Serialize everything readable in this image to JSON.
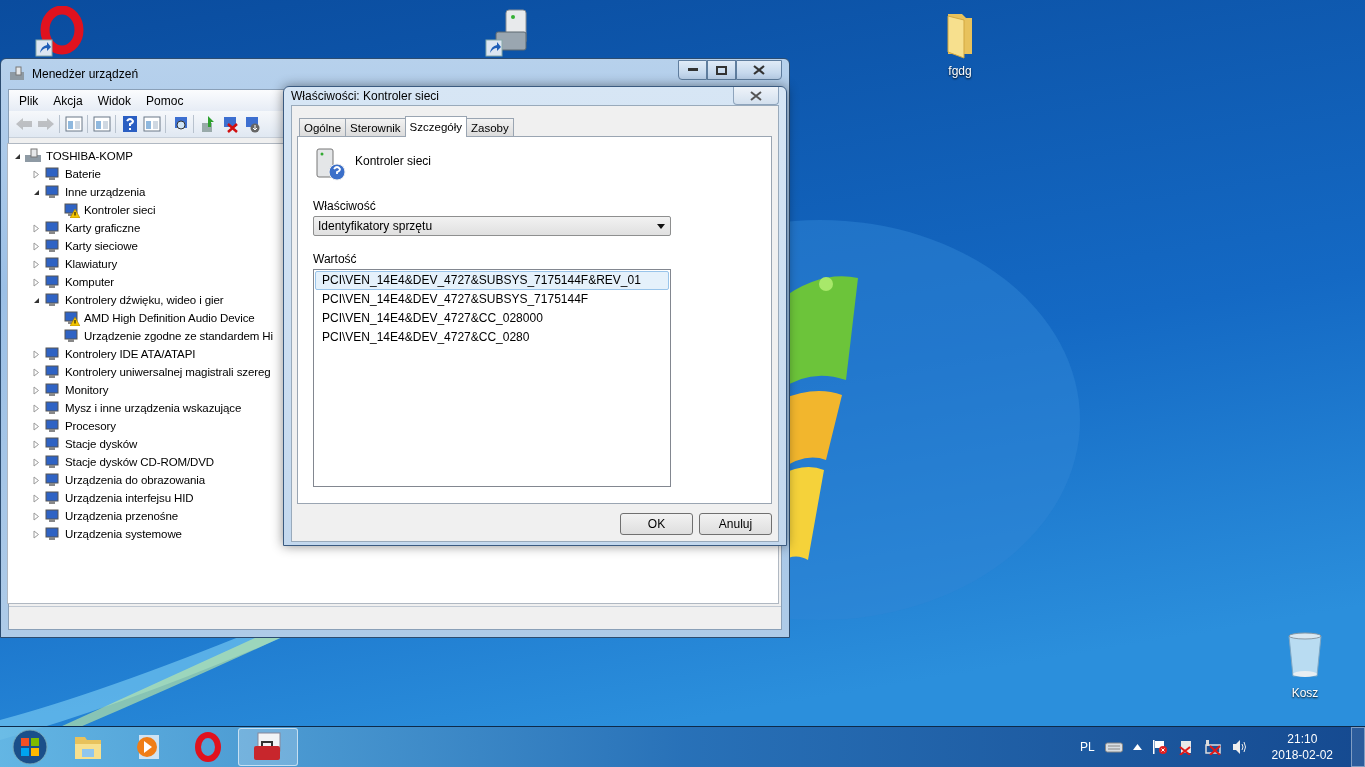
{
  "desktop_icons": [
    {
      "kind": "opera"
    },
    {
      "kind": "device-manager"
    },
    {
      "kind": "folder",
      "label": "fgdg"
    },
    {
      "kind": "recycle-bin",
      "label": "Kosz"
    }
  ],
  "device_manager": {
    "title": "Menedżer urządzeń",
    "menu": [
      "Plik",
      "Akcja",
      "Widok",
      "Pomoc"
    ],
    "toolbar": [
      {
        "kind": "back",
        "disabled": true
      },
      {
        "kind": "forward",
        "disabled": true
      },
      {
        "kind": "separator"
      },
      {
        "kind": "tree-view"
      },
      {
        "kind": "separator"
      },
      {
        "kind": "properties"
      },
      {
        "kind": "separator"
      },
      {
        "kind": "help"
      },
      {
        "kind": "action-view"
      },
      {
        "kind": "separator"
      },
      {
        "kind": "scan"
      },
      {
        "kind": "separator"
      },
      {
        "kind": "update"
      },
      {
        "kind": "uninstall"
      },
      {
        "kind": "disable"
      }
    ],
    "tree": [
      {
        "label": "TOSHIBA-KOMP",
        "expanded": true,
        "children": [
          {
            "label": "Baterie",
            "expanded": false
          },
          {
            "label": "Inne urządzenia",
            "expanded": true,
            "children": [
              {
                "label": "Kontroler sieci",
                "warning": true
              }
            ]
          },
          {
            "label": "Karty graficzne",
            "expanded": false
          },
          {
            "label": "Karty sieciowe",
            "expanded": false
          },
          {
            "label": "Klawiatury",
            "expanded": false
          },
          {
            "label": "Komputer",
            "expanded": false
          },
          {
            "label": "Kontrolery dźwięku, wideo i gier",
            "expanded": true,
            "children": [
              {
                "label": "AMD High Definition Audio Device",
                "warning": true
              },
              {
                "label": "Urządzenie zgodne ze standardem Hi",
                "warning": false
              }
            ]
          },
          {
            "label": "Kontrolery IDE ATA/ATAPI",
            "expanded": false
          },
          {
            "label": "Kontrolery uniwersalnej magistrali szereg",
            "expanded": false
          },
          {
            "label": "Monitory",
            "expanded": false
          },
          {
            "label": "Mysz i inne urządzenia wskazujące",
            "expanded": false
          },
          {
            "label": "Procesory",
            "expanded": false
          },
          {
            "label": "Stacje dysków",
            "expanded": false
          },
          {
            "label": "Stacje dysków CD-ROM/DVD",
            "expanded": false
          },
          {
            "label": "Urządzenia do obrazowania",
            "expanded": false
          },
          {
            "label": "Urządzenia interfejsu HID",
            "expanded": false
          },
          {
            "label": "Urządzenia przenośne",
            "expanded": false
          },
          {
            "label": "Urządzenia systemowe",
            "expanded": false
          }
        ]
      }
    ]
  },
  "dialog": {
    "title": "Właściwości: Kontroler sieci",
    "tabs": [
      {
        "label": "Ogólne",
        "selected": false
      },
      {
        "label": "Sterownik",
        "selected": false
      },
      {
        "label": "Szczegóły",
        "selected": true
      },
      {
        "label": "Zasoby",
        "selected": false
      }
    ],
    "device_name": "Kontroler sieci",
    "property_label": "Właściwość",
    "property_value": "Identyfikatory sprzętu",
    "value_label": "Wartość",
    "values": [
      {
        "text": "PCI\\VEN_14E4&DEV_4727&SUBSYS_7175144F&REV_01",
        "selected": true
      },
      {
        "text": "PCI\\VEN_14E4&DEV_4727&SUBSYS_7175144F",
        "selected": false
      },
      {
        "text": "PCI\\VEN_14E4&DEV_4727&CC_028000",
        "selected": false
      },
      {
        "text": "PCI\\VEN_14E4&DEV_4727&CC_0280",
        "selected": false
      }
    ],
    "buttons": [
      "OK",
      "Anuluj"
    ]
  },
  "taskbar": {
    "items": [
      {
        "kind": "explorer",
        "active": false
      },
      {
        "kind": "media-player",
        "active": false
      },
      {
        "kind": "opera",
        "active": false
      },
      {
        "kind": "device-manager",
        "active": true
      }
    ],
    "tray": {
      "language": "PL",
      "icons": [
        {
          "kind": "keyboard"
        },
        {
          "kind": "show-hidden"
        },
        {
          "kind": "action-center"
        },
        {
          "kind": "power"
        },
        {
          "kind": "network"
        },
        {
          "kind": "volume"
        }
      ],
      "time": "21:10",
      "date": "2018-02-02"
    }
  }
}
